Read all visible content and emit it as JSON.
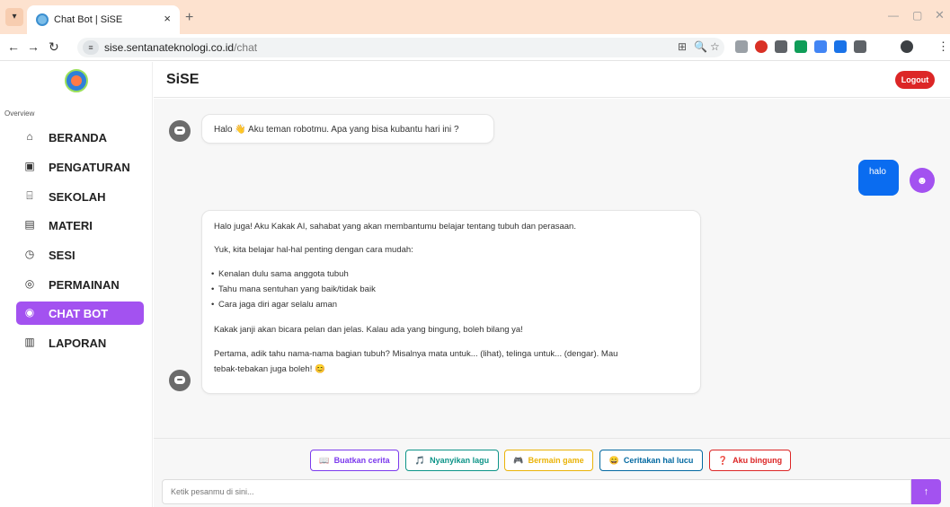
{
  "browser": {
    "tab_title": "Chat Bot | SiSE",
    "url_host": "sise.sentanateknologi.co.id",
    "url_path": "/chat"
  },
  "sidebar": {
    "section_label": "Overview",
    "items": [
      {
        "label": "BERANDA",
        "icon": "home-icon",
        "active": false
      },
      {
        "label": "PENGATURAN",
        "icon": "user-settings-icon",
        "active": false
      },
      {
        "label": "SEKOLAH",
        "icon": "school-icon",
        "active": false
      },
      {
        "label": "MATERI",
        "icon": "book-icon",
        "active": false
      },
      {
        "label": "SESI",
        "icon": "timer-icon",
        "active": false
      },
      {
        "label": "PERMAINAN",
        "icon": "gamepad-icon",
        "active": false
      },
      {
        "label": "CHAT BOT",
        "icon": "chat-icon",
        "active": true
      },
      {
        "label": "LAPORAN",
        "icon": "report-icon",
        "active": false
      }
    ]
  },
  "header": {
    "title": "SiSE",
    "logout_label": "Logout"
  },
  "chat": {
    "greeting": "Halo 👋 Aku teman robotmu. Apa yang bisa kubantu hari ini ?",
    "user_message": "halo",
    "reply": {
      "p1": "Halo juga! Aku Kakak AI, sahabat yang akan membantumu belajar tentang tubuh dan perasaan.",
      "p2": "Yuk, kita belajar hal-hal penting dengan cara mudah:",
      "bullets": [
        "Kenalan dulu sama anggota tubuh",
        "Tahu mana sentuhan yang baik/tidak baik",
        "Cara jaga diri agar selalu aman"
      ],
      "p3": "Kakak janji akan bicara pelan dan jelas. Kalau ada yang bingung, boleh bilang ya!",
      "p4_line1": "Pertama, adik tahu nama-nama bagian tubuh? Misalnya mata untuk... (lihat), telinga untuk... (dengar). Mau",
      "p4_line2": "tebak-tebakan juga boleh! 😊"
    }
  },
  "quick_replies": [
    {
      "label": "Buatkan cerita",
      "icon": "📖",
      "color": "#7c3aed"
    },
    {
      "label": "Nyanyikan lagu",
      "icon": "🎵",
      "color": "#0d9488"
    },
    {
      "label": "Bermain game",
      "icon": "🎮",
      "color": "#eab308"
    },
    {
      "label": "Ceritakan hal lucu",
      "icon": "😄",
      "color": "#0369a1"
    },
    {
      "label": "Aku bingung",
      "icon": "❓",
      "color": "#dc2626"
    }
  ],
  "composer": {
    "placeholder": "Ketik pesanmu di sini...",
    "send_icon": "↑"
  },
  "colors": {
    "accent": "#a352f0",
    "user_bubble": "#0a6cf0",
    "logout": "#dc2626"
  }
}
